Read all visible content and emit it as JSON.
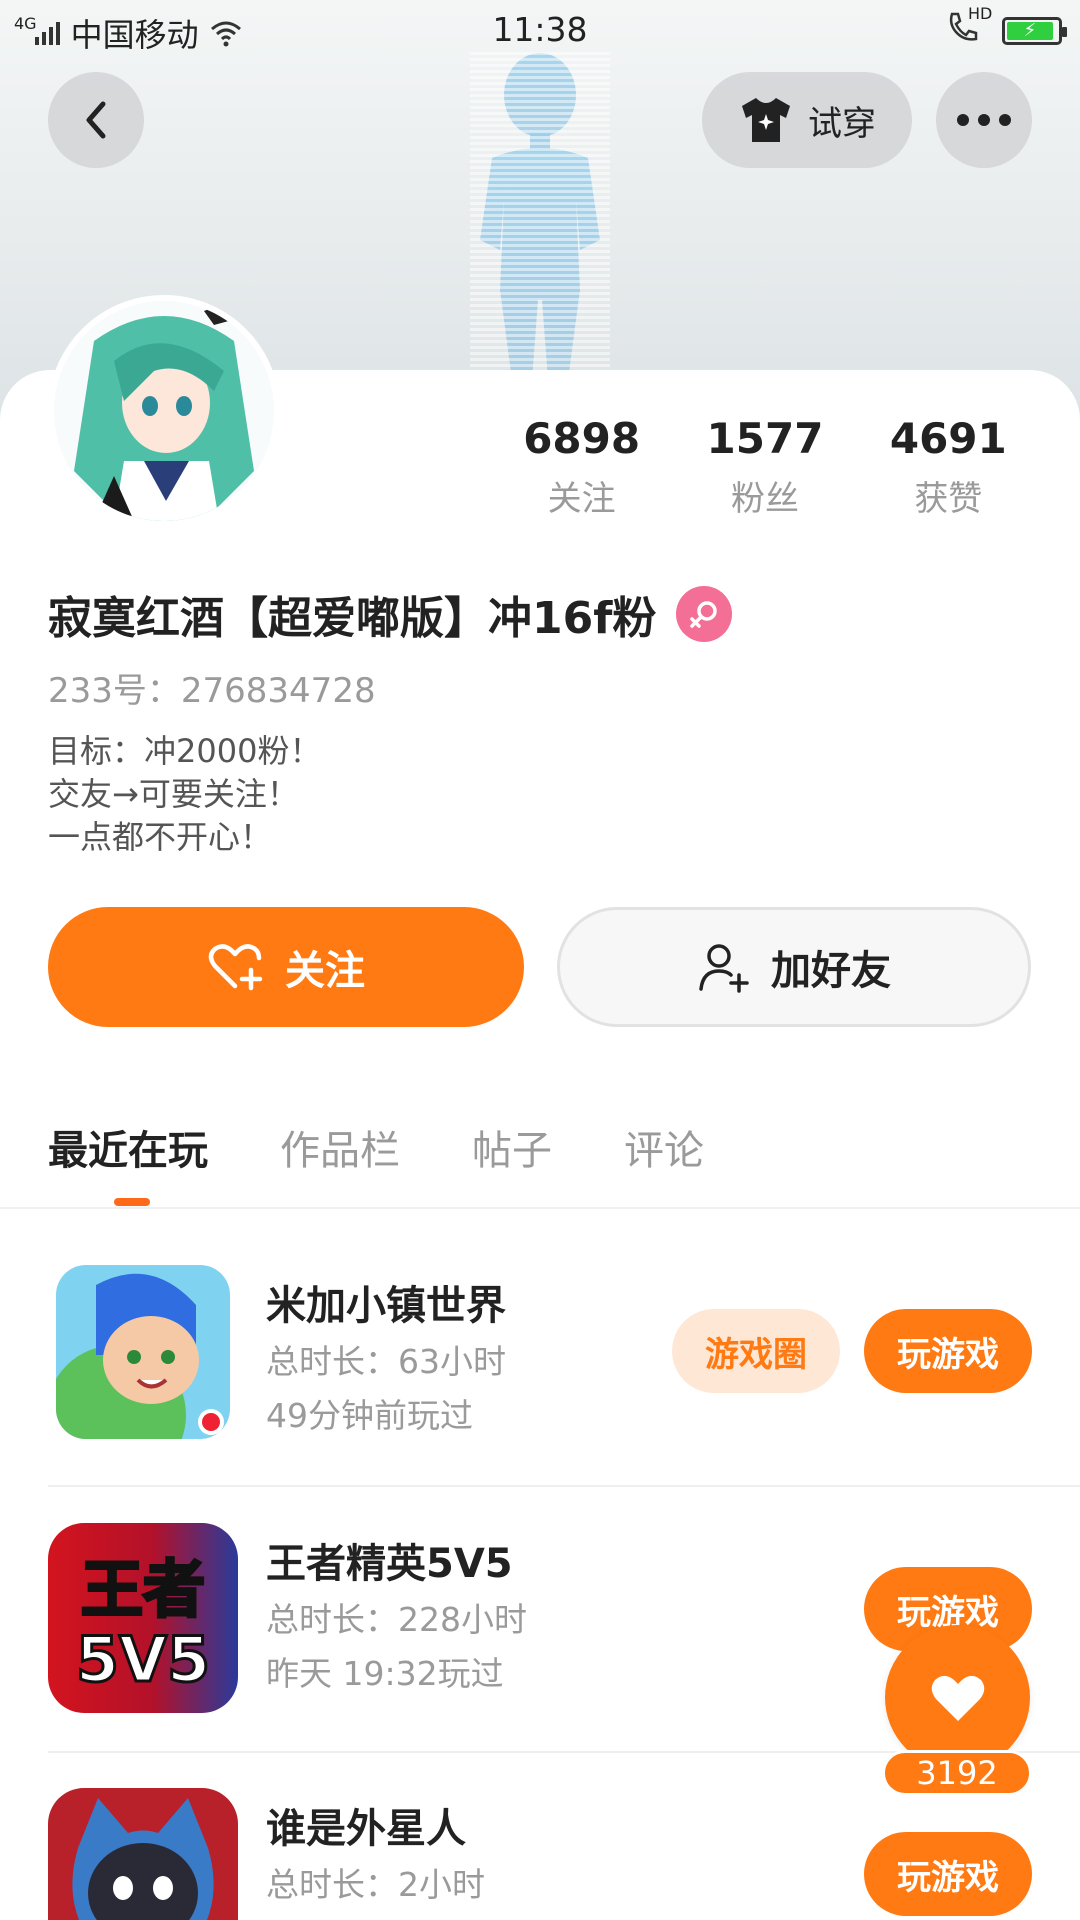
{
  "status_bar": {
    "network": "4G",
    "carrier": "中国移动",
    "time": "11:38",
    "call_badge": "HD"
  },
  "header": {
    "try_on_label": "试穿"
  },
  "profile": {
    "stats": [
      {
        "value": "6898",
        "label": "关注"
      },
      {
        "value": "1577",
        "label": "粉丝"
      },
      {
        "value": "4691",
        "label": "获赞"
      }
    ],
    "name": "寂寞红酒【超爱嘟版】冲16f粉",
    "uid": "233号：276834728",
    "bio": [
      "目标：冲2000粉！",
      "交友→可要关注！",
      "一点都不开心！"
    ],
    "follow_label": "关注",
    "add_friend_label": "加好友"
  },
  "tabs": [
    {
      "label": "最近在玩",
      "active": true
    },
    {
      "label": "作品栏",
      "active": false
    },
    {
      "label": "帖子",
      "active": false
    },
    {
      "label": "评论",
      "active": false
    }
  ],
  "games": [
    {
      "title": "米加小镇世界",
      "time": "总时长：63小时",
      "last": "49分钟前玩过",
      "circle_label": "游戏圈",
      "play_label": "玩游戏"
    },
    {
      "title": "王者精英5V5",
      "time": "总时长：228小时",
      "last": "昨天 19:32玩过",
      "play_label": "玩游戏",
      "icon_text": [
        "王者",
        "5V5"
      ]
    },
    {
      "title": "谁是外星人",
      "time": "总时长：2小时",
      "last": "",
      "play_label": "玩游戏"
    }
  ],
  "like_fab": {
    "count": "3192"
  },
  "colors": {
    "accent": "#ff7a12",
    "accent_light": "#ffe7d6",
    "gender_badge": "#f36f95"
  }
}
